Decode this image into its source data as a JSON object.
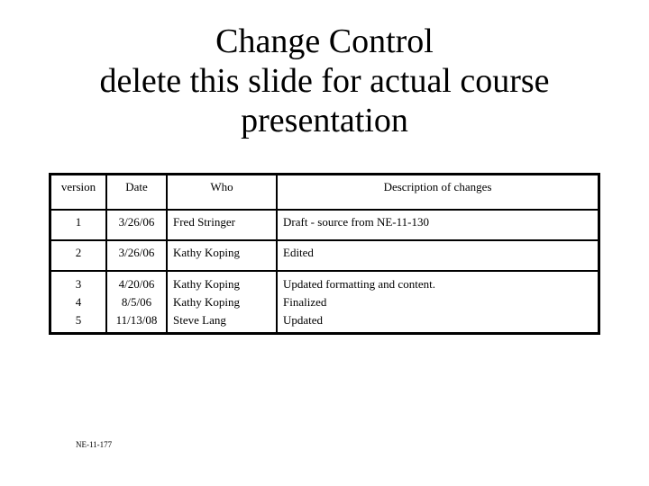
{
  "slide": {
    "title_lines": [
      "Change Control",
      "delete this slide for actual course",
      "presentation"
    ],
    "footer_code": "NE-11-177"
  },
  "table": {
    "headers": [
      "version",
      "Date",
      "Who",
      "Description of changes"
    ],
    "rows": [
      {
        "version": [
          "1"
        ],
        "date": [
          "3/26/06"
        ],
        "who": [
          "Fred Stringer"
        ],
        "description": [
          "Draft - source from NE-11-130"
        ]
      },
      {
        "version": [
          "2"
        ],
        "date": [
          "3/26/06"
        ],
        "who": [
          "Kathy Koping"
        ],
        "description": [
          "Edited"
        ]
      },
      {
        "version": [
          "3",
          "4",
          "5"
        ],
        "date": [
          "4/20/06",
          "8/5/06",
          "11/13/08"
        ],
        "who": [
          "Kathy Koping",
          "Kathy Koping",
          "Steve Lang"
        ],
        "description": [
          "Updated formatting and content.",
          "Finalized",
          "Updated"
        ]
      }
    ]
  }
}
